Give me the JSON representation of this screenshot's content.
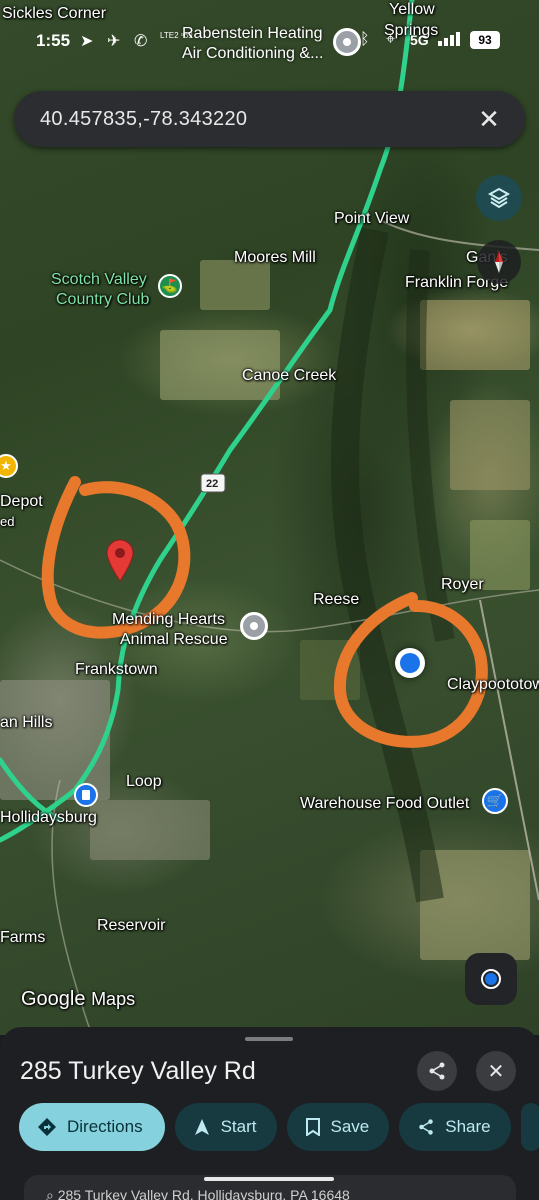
{
  "status_bar": {
    "time": "1:55",
    "lte": "LTE2 ᵊ69",
    "notification_line1": "Rabenstein Heating",
    "notification_line2": "Air Conditioning &...",
    "network": "5G",
    "battery": "93"
  },
  "search": {
    "query": "40.457835,-78.343220",
    "clear_icon": "close-icon"
  },
  "map": {
    "labels": {
      "sickles_corner": "Sickles Corner",
      "yellow_springs_1": "Yellow",
      "yellow_springs_2": "Springs",
      "point_view": "Point View",
      "moores_mill": "Moores Mill",
      "ganister": "Ganis",
      "franklin_forge": "Franklin Forge",
      "scotch_valley_1": "Scotch Valley",
      "scotch_valley_2": "Country Club",
      "canoe_creek": "Canoe Creek",
      "route_22": "22",
      "depot_1": "Depot",
      "depot_2": "ed",
      "royer": "Royer",
      "reese": "Reese",
      "mending_1": "Mending Hearts",
      "mending_2": "Animal Rescue",
      "frankstown": "Frankstown",
      "claypottown": "Claypoototow",
      "hills": "an Hills",
      "loop": "Loop",
      "warehouse": "Warehouse Food Outlet",
      "hollidaysburg": "Hollidaysburg",
      "reservoir": "Reservoir",
      "farms": "Farms",
      "google": "Google",
      "maps": "Maps"
    },
    "colors": {
      "route": "#2fd28c",
      "annotation": "#e8782c",
      "pin": "#e53935",
      "my_location": "#1a73e8"
    }
  },
  "sheet": {
    "title": "285 Turkey Valley Rd",
    "actions": [
      {
        "label": "Directions",
        "icon": "directions-icon"
      },
      {
        "label": "Start",
        "icon": "navigation-arrow-icon"
      },
      {
        "label": "Save",
        "icon": "bookmark-icon"
      },
      {
        "label": "Share",
        "icon": "share-icon"
      }
    ],
    "address_preview": "285 Turkey Valley Rd, Hollidaysburg, PA 16648"
  }
}
